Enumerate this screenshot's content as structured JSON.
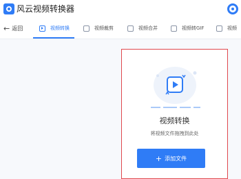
{
  "app": {
    "title": "风云视频转换器",
    "logo_icon": "video-converter-logo-icon"
  },
  "toolbar": {
    "back_label": "返回",
    "tabs": [
      {
        "label": "视频转换",
        "icon": "video-convert-icon",
        "active": true
      },
      {
        "label": "视频裁剪",
        "icon": "video-crop-icon",
        "active": false
      },
      {
        "label": "视频合并",
        "icon": "video-merge-icon",
        "active": false
      },
      {
        "label": "视频转GIF",
        "icon": "video-gif-icon",
        "active": false
      },
      {
        "label": "视频",
        "icon": "video-image-icon",
        "active": false
      }
    ]
  },
  "dropzone": {
    "title": "视频转换",
    "subtitle": "将视频文件拖拽到此处",
    "button_label": "添加文件",
    "button_icon": "plus-icon"
  },
  "colors": {
    "accent": "#2f7cf6",
    "highlight_border": "#e0474c",
    "background": "#f7f9fc"
  }
}
